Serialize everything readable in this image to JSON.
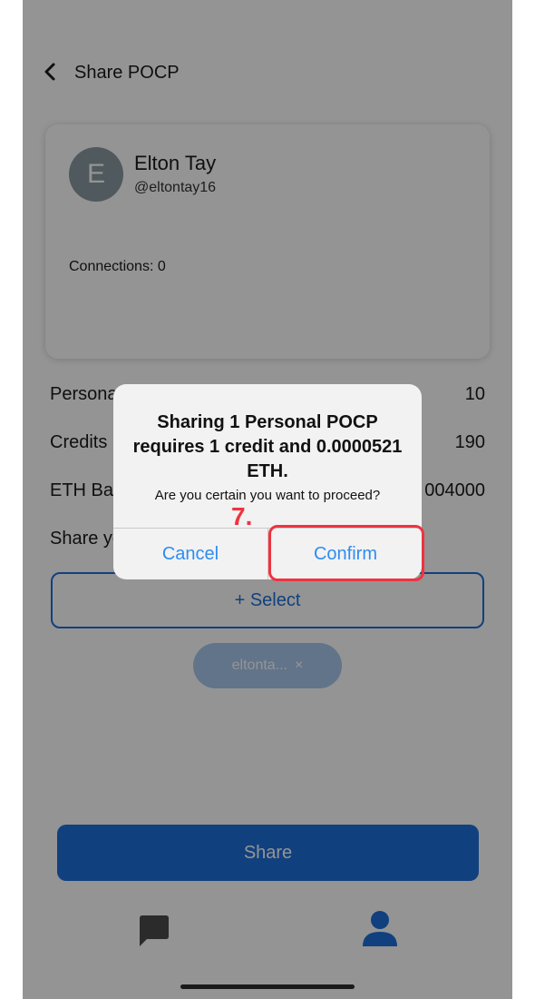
{
  "header": {
    "title": "Share POCP",
    "back_icon": "chevron-left-icon"
  },
  "profile": {
    "avatar_letter": "E",
    "name": "Elton Tay",
    "handle": "@eltontay16",
    "connections": "Connections: 0"
  },
  "stats": [
    {
      "label": "Persona",
      "value": "10"
    },
    {
      "label": "Credits",
      "value": "190"
    },
    {
      "label": "ETH Bal",
      "value": "004000"
    }
  ],
  "share_prompt": "Share yo",
  "select_label": "+ Select",
  "chip": {
    "label": "eltonta...",
    "remove": "×"
  },
  "share_label": "Share",
  "tabbar": {
    "chat_icon": "chat-icon",
    "profile_icon": "profile-icon"
  },
  "dialog": {
    "title": "Sharing 1 Personal POCP requires 1 credit and 0.0000521 ETH.",
    "message": "Are you certain you want to proceed?",
    "cancel": "Cancel",
    "confirm": "Confirm"
  },
  "annotation": {
    "step": "7.",
    "color": "#ef3340"
  },
  "colors": {
    "accent": "#1e6fd9",
    "dialog_button": "#2f8cf0"
  }
}
